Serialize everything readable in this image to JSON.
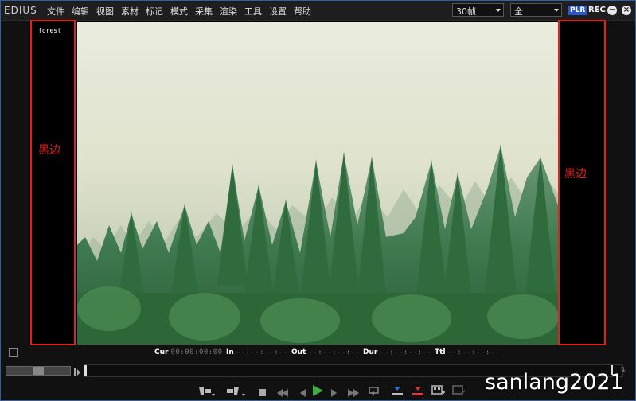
{
  "app": {
    "logo": "EDIUS"
  },
  "menu": [
    "文件",
    "编辑",
    "视图",
    "素材",
    "标记",
    "模式",
    "采集",
    "渲染",
    "工具",
    "设置",
    "帮助"
  ],
  "toolbar": {
    "frame_rate": "30帧",
    "view_mode": "全",
    "plr": "PLR",
    "rec": "REC",
    "minimize": "−",
    "close": "×"
  },
  "preview": {
    "clip_name": "forest",
    "left_bar_label": "黑边",
    "right_bar_label": "黑边"
  },
  "timecodes": {
    "cur_label": "Cur",
    "cur_value": "00:00:00:00",
    "in_label": "In",
    "in_value": "--:--:--:--",
    "out_label": "Out",
    "out_value": "--:--:--:--",
    "dur_label": "Dur",
    "dur_value": "--:--:--:--",
    "ttl_label": "Ttl",
    "ttl_value": "--:--:--:--"
  },
  "icons": {
    "set_in": "set-in-icon",
    "set_out": "set-out-icon",
    "stop": "stop-icon",
    "rewind": "rewind-icon",
    "prev_frame": "previous-frame-icon",
    "play": "play-icon",
    "next_frame": "next-frame-icon",
    "fast_forward": "fast-forward-icon",
    "loop": "loop-icon",
    "insert": "insert-to-timeline-icon",
    "overwrite": "overwrite-to-timeline-icon",
    "add_clip": "add-clip-icon",
    "export_clip": "export-clip-icon"
  },
  "colors": {
    "accent": "#2b58c7",
    "annotation": "#e0221b",
    "play_green": "#3fae3a"
  },
  "watermark": "sanlang2021"
}
